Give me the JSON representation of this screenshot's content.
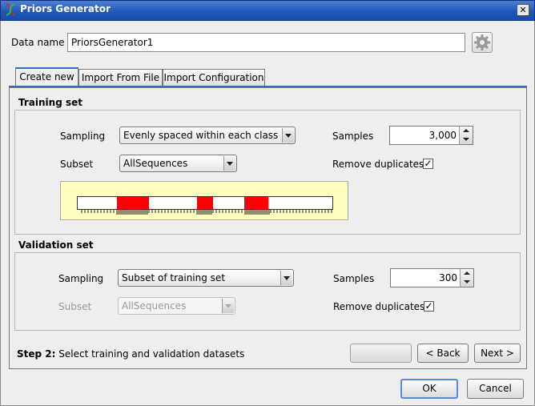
{
  "window": {
    "title": "Priors Generator",
    "close_glyph": "✕"
  },
  "header": {
    "data_name_label": "Data name",
    "data_name_value": "PriorsGenerator1"
  },
  "tabs": [
    {
      "label": "Create new",
      "active": true
    },
    {
      "label": "Import From File",
      "active": false
    },
    {
      "label": "Import Configuration",
      "active": false
    }
  ],
  "training": {
    "title": "Training set",
    "sampling_label": "Sampling",
    "sampling_value": "Evenly spaced within each class",
    "samples_label": "Samples",
    "samples_value": "3,000",
    "subset_label": "Subset",
    "subset_value": "AllSequences",
    "remove_duplicates_label": "Remove duplicates",
    "remove_duplicates_checked": true,
    "preview": {
      "highlight_color": "#ff0000",
      "segments": [
        {
          "start": 0.155,
          "end": 0.28
        },
        {
          "start": 0.468,
          "end": 0.53
        },
        {
          "start": 0.655,
          "end": 0.75
        }
      ]
    }
  },
  "validation": {
    "title": "Validation set",
    "sampling_label": "Sampling",
    "sampling_value": "Subset of training set",
    "samples_label": "Samples",
    "samples_value": "300",
    "subset_label": "Subset",
    "subset_value": "AllSequences",
    "subset_enabled": false,
    "remove_duplicates_label": "Remove duplicates",
    "remove_duplicates_checked": true
  },
  "wizard": {
    "step_prefix": "Step 2:",
    "step_text": " Select training and validation datasets",
    "back_label": "< Back",
    "next_label": "Next >"
  },
  "footer": {
    "ok_label": "OK",
    "cancel_label": "Cancel"
  },
  "colors": {
    "titlebar": "#1f55b8",
    "highlight": "#ff0000",
    "preview_bg": "#ffffc0",
    "tab_accent": "#3c6bb8"
  },
  "icons": {
    "app": "dna-icon",
    "settings": "gear-icon",
    "check": "✓"
  }
}
